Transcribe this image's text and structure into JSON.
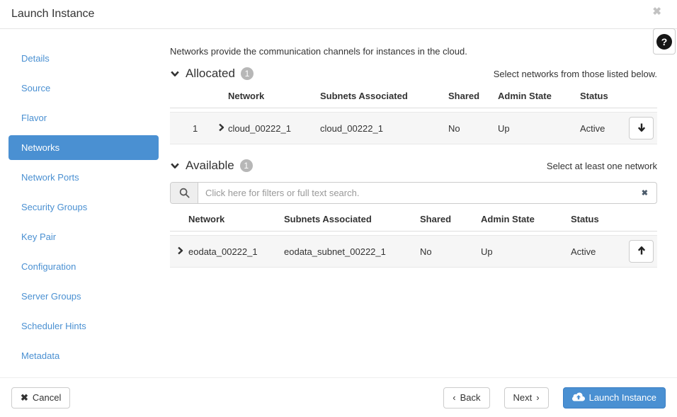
{
  "header": {
    "title": "Launch Instance",
    "icons": {
      "close": "✖",
      "help": "?"
    }
  },
  "sidebar": {
    "items": [
      {
        "label": "Details",
        "active": false
      },
      {
        "label": "Source",
        "active": false
      },
      {
        "label": "Flavor",
        "active": false
      },
      {
        "label": "Networks",
        "active": true
      },
      {
        "label": "Network Ports",
        "active": false
      },
      {
        "label": "Security Groups",
        "active": false
      },
      {
        "label": "Key Pair",
        "active": false
      },
      {
        "label": "Configuration",
        "active": false
      },
      {
        "label": "Server Groups",
        "active": false
      },
      {
        "label": "Scheduler Hints",
        "active": false
      },
      {
        "label": "Metadata",
        "active": false
      }
    ]
  },
  "main": {
    "description": "Networks provide the communication channels for instances in the cloud.",
    "allocated": {
      "title": "Allocated",
      "count": "1",
      "hint": "Select networks from those listed below.",
      "columns": [
        "Network",
        "Subnets Associated",
        "Shared",
        "Admin State",
        "Status"
      ],
      "row": {
        "index": "1",
        "network": "cloud_00222_1",
        "subnets": "cloud_00222_1",
        "shared": "No",
        "admin_state": "Up",
        "status": "Active"
      }
    },
    "available": {
      "title": "Available",
      "count": "1",
      "hint": "Select at least one network",
      "search": {
        "placeholder": "Click here for filters or full text search.",
        "value": "",
        "clear_icon": "✖"
      },
      "columns": [
        "Network",
        "Subnets Associated",
        "Shared",
        "Admin State",
        "Status"
      ],
      "row": {
        "network": "eodata_00222_1",
        "subnets": "eodata_subnet_00222_1",
        "shared": "No",
        "admin_state": "Up",
        "status": "Active"
      }
    }
  },
  "footer": {
    "cancel_label": "Cancel",
    "cancel_icon": "✖",
    "back_label": "Back",
    "back_chevron": "‹",
    "next_label": "Next",
    "next_chevron": "›",
    "launch_label": "Launch Instance"
  },
  "colors": {
    "accent": "#4a90d2",
    "accent_border": "#3b7fc4",
    "row_background": "#f6f6f6",
    "badge_gray": "#b7b7b7",
    "border_gray": "#ddd"
  }
}
